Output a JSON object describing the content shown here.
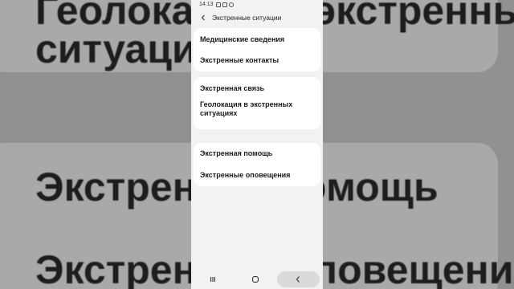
{
  "background": {
    "line1": "Геолокация в экстренных",
    "line2": "ситуациях",
    "line3": "Экстренная помощь",
    "line4": "Экстренные оповещения"
  },
  "status_bar": {
    "time": "14:13",
    "icons": [
      "sim-icon",
      "video-icon",
      "search-icon"
    ]
  },
  "header": {
    "back_icon": "back-arrow-icon",
    "title": "Экстренные ситуации"
  },
  "groups": [
    {
      "items": [
        "Медицинские сведения",
        "Экстренные контакты"
      ]
    },
    {
      "items": [
        "Экстренная связь",
        "Геолокация в экстренных ситуациях"
      ]
    },
    {
      "items": [
        "Экстренная помощь",
        "Экстренные оповещения"
      ]
    }
  ],
  "nav_bar": {
    "recents_icon": "recents-icon",
    "home_icon": "home-icon",
    "back_icon": "back-icon"
  },
  "colors": {
    "screen_bg": "#f2f2f2",
    "card_bg": "#ffffff",
    "text": "#1a1a1a",
    "backdrop": "#919191"
  }
}
